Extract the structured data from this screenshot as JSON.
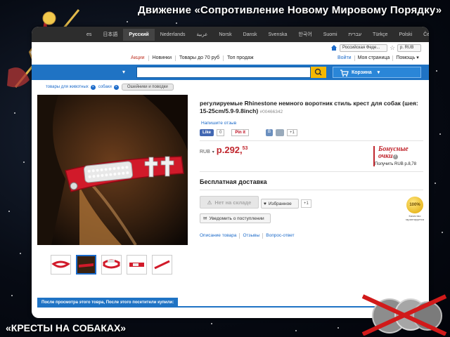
{
  "slide": {
    "title": "Движение «Сопротивление Новому Мировому Порядку»",
    "caption": "«КРЕСТЫ НА СОБАКАХ»"
  },
  "langbar": {
    "languages": [
      "es",
      "日本語",
      "Русский",
      "Nederlands",
      "عربية",
      "Norsk",
      "Dansk",
      "Svenska",
      "한국어",
      "Suomi",
      "עברית",
      "Türkçe",
      "Polski",
      "Čeština"
    ],
    "active_index": 2
  },
  "header": {
    "country_select": "Российская Феде...",
    "currency_select": "р. RUB",
    "menu_links": [
      "Акции",
      "Новинки",
      "Товары до 70 руб",
      "Топ продаж"
    ],
    "right_links": [
      "Войти",
      "Моя страница",
      "Помощь ▾"
    ],
    "cart_label": "Корзина"
  },
  "breadcrumbs": {
    "items": [
      "товары для животных",
      "собаки"
    ],
    "current": "Ошейники и поводки"
  },
  "product": {
    "title": "регулируемые Rhinestone немного воротник стиль крест для собак (шея: 15-25cm/5.9-9.8inch)",
    "sku": "#00466342",
    "review_link": "Напишите отзыв",
    "fb_like": "Like",
    "fb_count": "0",
    "pin_label": "Pin it",
    "vk_label": "B",
    "gplus_label": "+1",
    "currency": "RUB",
    "price_main": "р.292,",
    "price_cents": "53",
    "bonus_title": "Бонусные очки",
    "bonus_sub": "Получить RUB р.8,78",
    "shipping": "Бесплатная доставка",
    "oos_button": "Нет на складе",
    "fav_button": "Избранное",
    "fav_count": "+1",
    "notify_button": "Уведомить о поступлении",
    "guarantee_badge": "100%",
    "guarantee_text": "Качество гарантируется",
    "tabs": [
      "Описание товара",
      "Отзывы",
      "Вопрос-ответ"
    ]
  },
  "bottom": {
    "tab_label": "После просмотра этого товра, После этого посетители купили:"
  },
  "colors": {
    "accent_blue": "#1f73c4",
    "price_red": "#c0262d",
    "collar_red": "#d11a2a",
    "search_yellow": "#f5b800"
  }
}
